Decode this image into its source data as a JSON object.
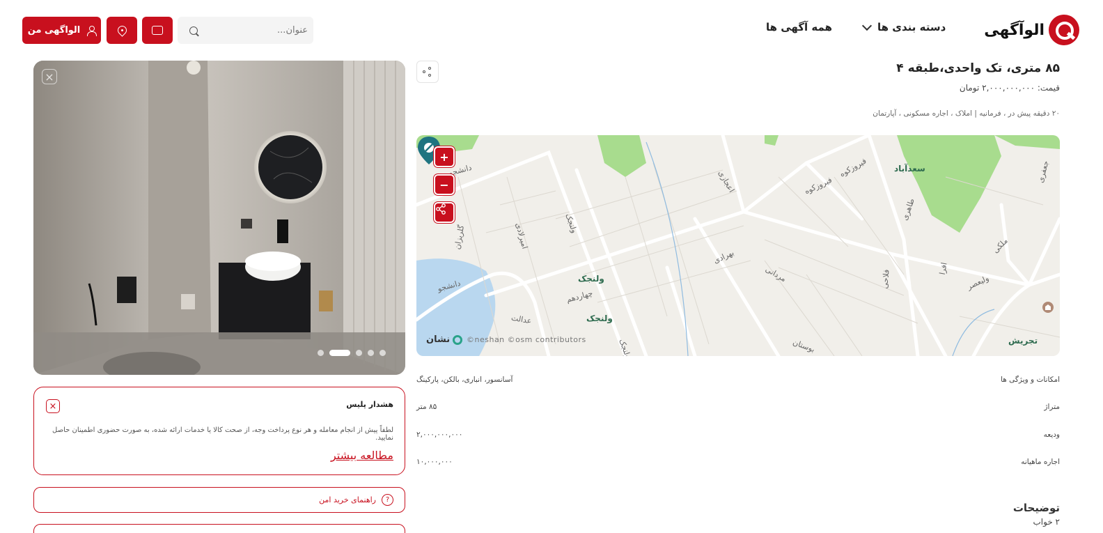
{
  "header": {
    "logo_text": "الوآگهی",
    "categories_label": "دسته بندی ها",
    "all_ads_label": "همه آگهی ها",
    "search_placeholder": "عنوان...",
    "my_account_label": "الواگهی من"
  },
  "listing": {
    "title": "۸۵ متری، تک واحدی،طبقه ۴",
    "price": "قیمت: ۲,۰۰۰,۰۰۰,۰۰۰ تومان",
    "meta": "۲۰ دقیقه پیش در ، فرمانیه |   املاک ، اجاره مسکونی ، آپارتمان"
  },
  "map": {
    "labels": [
      "سعدآباد",
      "ولنجک",
      "ولنجک",
      "تجریش",
      "ولیعصر",
      "چهاردهم",
      "عدالت",
      "مردانی",
      "بهرادی",
      "اعجازی",
      "فیروزکوه",
      "فیروزکوه",
      "طاهری",
      "دانشجو",
      "دانشجو",
      "امیرلادی",
      "ولنجک",
      "گلریزان",
      "فلاحی",
      "افرا",
      "ملکی",
      "جعفری",
      "بوستان",
      "ولنجک"
    ],
    "brand": "نشان",
    "copyright": "©neshan ©osm contributors"
  },
  "attributes": [
    {
      "key": "امکانات و ویژگی ها",
      "value": "آسانسور، انباری، بالکن، پارکینگ"
    },
    {
      "key": "متراژ",
      "value": "۸۵ متر"
    },
    {
      "key": "ودیعه",
      "value": "۲,۰۰۰,۰۰۰,۰۰۰"
    },
    {
      "key": "اجاره ماهیانه",
      "value": "۱۰,۰۰۰,۰۰۰"
    }
  ],
  "description": {
    "title": "توضیحات",
    "text": "۲ خواب"
  },
  "gallery": {
    "dot_count": 5,
    "active_index": 1
  },
  "police_warning": {
    "title": "هشدار پلیس",
    "text": "لطفاً پیش از انجام معامله و هر نوع پرداخت وجه، از صحت کالا یا خدمات ارائه شده، به صورت حضوری اطمینان حاصل نمایید.",
    "link": "مطالعه بیشتر"
  },
  "safe_guide": {
    "label": "راهنمای خرید امن",
    "icon": "?"
  },
  "colors": {
    "brand_red": "#c8101e",
    "marker_teal": "#1f7480",
    "map_green": "#a8dc8e",
    "map_water": "#b9d7ef"
  }
}
